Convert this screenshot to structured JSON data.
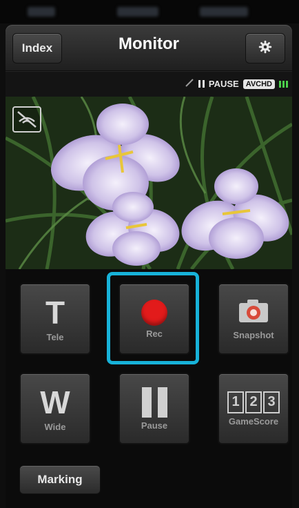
{
  "header": {
    "index_label": "Index",
    "title": "Monitor",
    "settings_icon": "gear-icon"
  },
  "status": {
    "state": "PAUSE",
    "format": "AVCHD"
  },
  "controls": {
    "tele": {
      "glyph": "T",
      "label": "Tele"
    },
    "rec": {
      "label": "Rec"
    },
    "snapshot": {
      "label": "Snapshot"
    },
    "wide": {
      "glyph": "W",
      "label": "Wide"
    },
    "pause": {
      "label": "Pause"
    },
    "gamescore": {
      "digits": [
        "1",
        "2",
        "3"
      ],
      "label": "GameScore"
    },
    "marking_label": "Marking"
  },
  "colors": {
    "highlight": "#17b2d9",
    "record": "#e21b1b",
    "battery": "#4bd04b"
  }
}
